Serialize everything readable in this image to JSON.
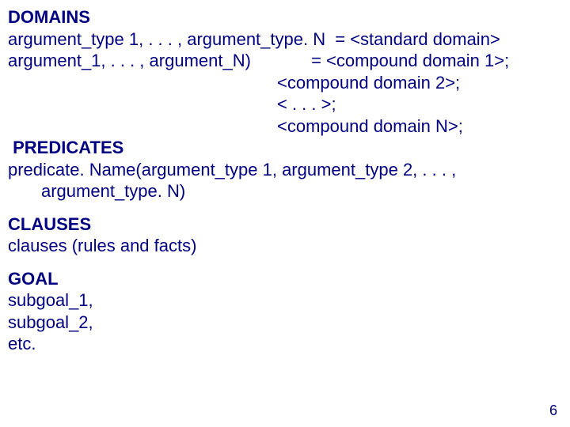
{
  "domains": {
    "heading": "DOMAINS",
    "line1_left": "argument_type 1, . . . , argument_type. N",
    "line1_right": "= <standard domain>",
    "line2_left": "argument_1, . . . , argument_N)",
    "line2_right": "= <compound domain 1>;",
    "line3": "<compound domain 2>;",
    "line4": "< . . . >;",
    "line5": "<compound domain N>;"
  },
  "predicates": {
    "heading": "PREDICATES",
    "line1": "predicate. Name(argument_type 1, argument_type 2, . . . ,",
    "line2": "argument_type. N)"
  },
  "clauses": {
    "heading": "CLAUSES",
    "line1": "clauses (rules and facts)"
  },
  "goal": {
    "heading": "GOAL",
    "line1": "subgoal_1,",
    "line2": "subgoal_2,",
    "line3": "etc."
  },
  "page_number": "6"
}
